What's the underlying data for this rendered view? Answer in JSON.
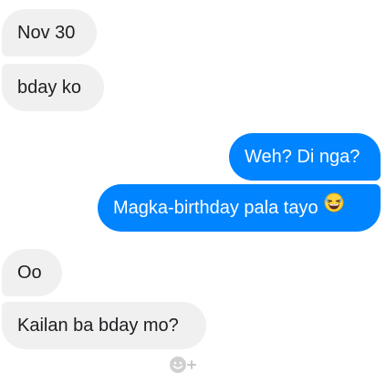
{
  "messages": [
    {
      "direction": "incoming",
      "text": "Nov 30"
    },
    {
      "direction": "incoming",
      "text": "bday ko"
    },
    {
      "direction": "outgoing",
      "text": "Weh? Di nga?"
    },
    {
      "direction": "outgoing",
      "text": "Magka-birthday pala tayo",
      "emoji": "laughing-emoji-icon"
    },
    {
      "direction": "incoming",
      "text": "Oo"
    },
    {
      "direction": "incoming",
      "text": "Kailan ba bday mo?"
    }
  ],
  "colors": {
    "incoming_bg": "#f1f0f0",
    "incoming_text": "#1c1e21",
    "outgoing_bg": "#0084ff",
    "outgoing_text": "#ffffff",
    "reaction_icon": "#c8c8c8"
  },
  "reaction_button": {
    "icon": "add-reaction-icon"
  }
}
